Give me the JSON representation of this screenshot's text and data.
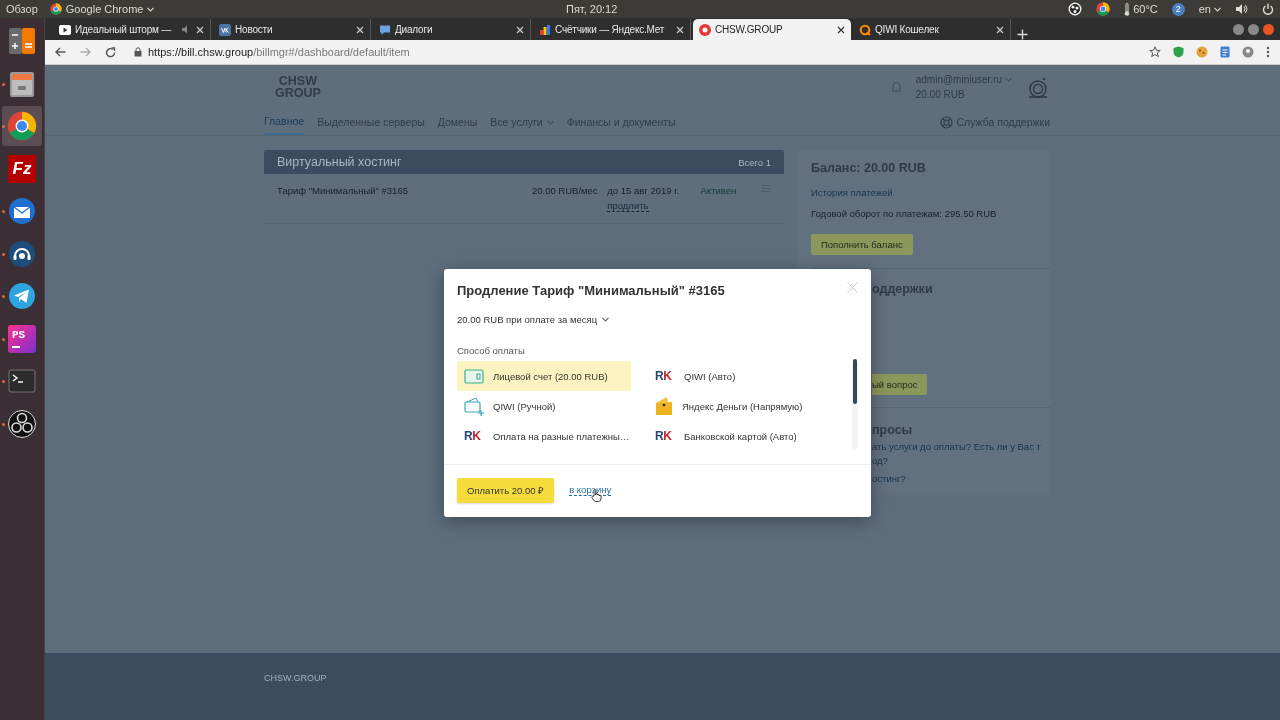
{
  "top_bar": {
    "activities": "Обзор",
    "app_menu": "Google Chrome",
    "clock": "Пят, 20:12",
    "temperature": "60°C",
    "notification_count": "2",
    "keyboard_layout": "en"
  },
  "dock": [
    {
      "kind": "calculator",
      "running": false,
      "selected": false
    },
    {
      "kind": "files",
      "running": true,
      "selected": false
    },
    {
      "kind": "chrome",
      "running": true,
      "selected": true
    },
    {
      "kind": "filezilla",
      "label": "Fz",
      "running": false,
      "selected": false
    },
    {
      "kind": "mail",
      "running": true,
      "selected": false
    },
    {
      "kind": "support",
      "running": true,
      "selected": false
    },
    {
      "kind": "telegram",
      "running": true,
      "selected": false
    },
    {
      "kind": "phpstorm",
      "label": "PS",
      "running": true,
      "selected": false
    },
    {
      "kind": "terminal",
      "running": true,
      "selected": false
    },
    {
      "kind": "obs",
      "running": true,
      "selected": false
    }
  ],
  "browser": {
    "tabs": [
      {
        "kind": "video",
        "title": "Идеальный шторм —",
        "selected": false
      },
      {
        "kind": "vk",
        "title": "Новости",
        "selected": false
      },
      {
        "kind": "chat",
        "title": "Диалоги",
        "selected": false
      },
      {
        "kind": "metrica",
        "title": "Счётчики — Яндекс.Мет",
        "selected": false
      },
      {
        "kind": "site",
        "title": "CHSW.GROUP",
        "selected": true
      },
      {
        "kind": "qiwi",
        "title": "QIWI Кошелек",
        "selected": false
      }
    ],
    "url_host": "https://bill.chsw.group",
    "url_path": "/billmgr#/dashboard/default/item"
  },
  "site": {
    "logo": [
      "CHSW",
      "GROUP"
    ],
    "user_email": "admin@miniuser.ru",
    "user_balance": "20.00 RUB",
    "nav": [
      {
        "label": "Главное",
        "selected": true,
        "dropdown": false
      },
      {
        "label": "Выделенные серверы",
        "selected": false,
        "dropdown": false
      },
      {
        "label": "Домены",
        "selected": false,
        "dropdown": false
      },
      {
        "label": "Все услуги",
        "selected": false,
        "dropdown": true
      },
      {
        "label": "Финансы и документы",
        "selected": false,
        "dropdown": false
      }
    ],
    "support_link": "Служба поддержки",
    "hosting": {
      "title": "Виртуальный хостинг",
      "total": "Всего 1",
      "rows": [
        {
          "name": "Тариф \"Минимальный\" #3165",
          "price": "20.00 RUB/мес",
          "expires": "до 15 авг 2019 г.",
          "renew": "продлить",
          "status": "Активен"
        }
      ]
    },
    "balance": {
      "title": "Баланс: 20.00 RUB",
      "history_link": "История платежей",
      "turnover": "Годовой оборот по платежам: 295.50 RUB",
      "top_up": "Пополнить баланс"
    },
    "support": {
      "title": "оддержки",
      "ask_button": "ый вопрос"
    },
    "faq": {
      "title": "просы",
      "links": [
        "ать услуги до оплаты? Есть ли у Вас т",
        "од?",
        "остинг?"
      ]
    },
    "footer": "CHSW.GROUP"
  },
  "modal": {
    "title": "Продление Тариф \"Минимальный\" #3165",
    "period": "20.00 RUB при оплате за месяц",
    "methods_label": "Способ оплаты",
    "methods": [
      {
        "kind": "account",
        "label": "Лицевой счет (20.00 RUB)",
        "selected": true
      },
      {
        "kind": "rk",
        "logo_text": "RK",
        "label": "QIWI (Авто)",
        "selected": false
      },
      {
        "kind": "wallet",
        "label": "QIWI (Ручной)",
        "selected": false
      },
      {
        "kind": "yandex",
        "label": "Яндекс Деньги (Напрямую)",
        "selected": false
      },
      {
        "kind": "rk",
        "logo_text": "RK",
        "label": "Оплата на разные платежны…",
        "selected": false
      },
      {
        "kind": "rk",
        "logo_text": "RK",
        "label": "Банковской картой (Авто)",
        "selected": false
      }
    ],
    "pay_button": "Оплатить 20.00 ₽",
    "cart_link": "в корзину"
  }
}
